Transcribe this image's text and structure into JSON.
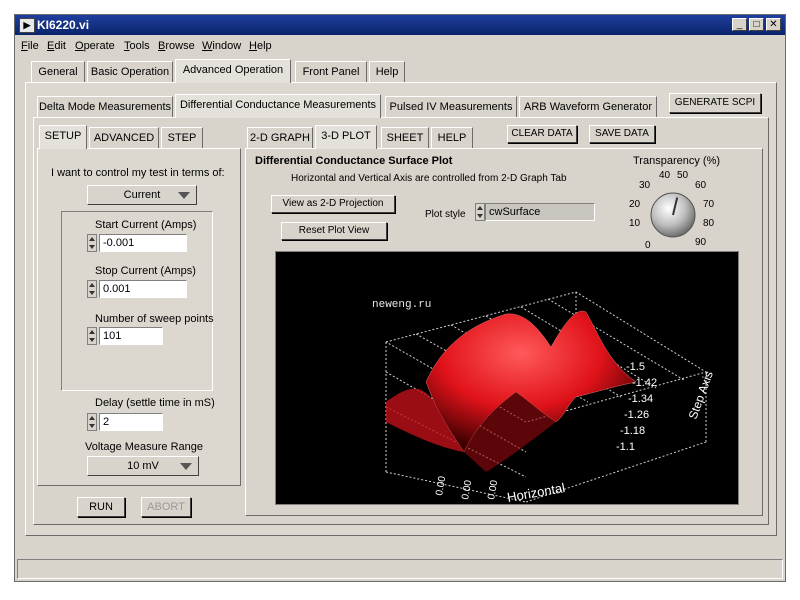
{
  "window": {
    "title": "KI6220.vi",
    "title_icon_glyph": "▶",
    "controls": {
      "minimize": "_",
      "maximize": "□",
      "close": "✕"
    }
  },
  "menu": [
    "File",
    "Edit",
    "Operate",
    "Tools",
    "Browse",
    "Window",
    "Help"
  ],
  "main_tabs": [
    "General",
    "Basic Operation",
    "Advanced Operation",
    "Front Panel",
    "Help"
  ],
  "main_tabs_active": "Advanced Operation",
  "sub_tabs": [
    "Delta Mode Measurements",
    "Differential Conductance Measurements",
    "Pulsed IV Measurements",
    "ARB Waveform Generator"
  ],
  "sub_tabs_active": "Differential Conductance Measurements",
  "generate_scpi_label": "GENERATE SCPI",
  "left_tabs": [
    "SETUP",
    "ADVANCED",
    "STEP"
  ],
  "left_tabs_active": "SETUP",
  "setup": {
    "control_prompt": "I want to control my test in terms of:",
    "control_mode": "Current",
    "start_label": "Start Current (Amps)",
    "start_value": "-0.001",
    "stop_label": "Stop Current (Amps)",
    "stop_value": "0.001",
    "points_label": "Number of sweep points",
    "points_value": "101",
    "delay_label": "Delay (settle time in mS)",
    "delay_value": "2",
    "range_label": "Voltage Measure Range",
    "range_value": "10 mV"
  },
  "run_label": "RUN",
  "abort_label": "ABORT",
  "right_tabs": [
    "2-D GRAPH",
    "3-D PLOT",
    "SHEET",
    "HELP"
  ],
  "right_tabs_active": "3-D PLOT",
  "clear_data_label": "CLEAR DATA",
  "save_data_label": "SAVE DATA",
  "plot_panel": {
    "title": "Differential Conductance Surface Plot",
    "subtitle": "Horizontal and Vertical Axis are controlled from 2-D Graph Tab",
    "view_2d_label": "View as 2-D Projection",
    "reset_view_label": "Reset Plot View",
    "plot_style_label": "Plot style",
    "plot_style_value": "cwSurface"
  },
  "transparency": {
    "label": "Transparency (%)",
    "ticks": [
      "0",
      "10",
      "20",
      "30",
      "40",
      "50",
      "60",
      "70",
      "80",
      "90"
    ],
    "value": 55
  },
  "plot_3d": {
    "watermark": "neweng.ru",
    "step_axis_title": "Step Axis",
    "step_ticks": [
      "-1.5",
      "-1.42",
      "-1.34",
      "-1.26",
      "-1.18",
      "-1.1"
    ],
    "horizontal_axis_title": "Horizontal",
    "horizontal_ticks": [
      "0.00",
      "0.00",
      "0.00"
    ],
    "colors": {
      "surface": "#e0121a",
      "grid": "#cfcfcf",
      "background": "#000000"
    }
  }
}
